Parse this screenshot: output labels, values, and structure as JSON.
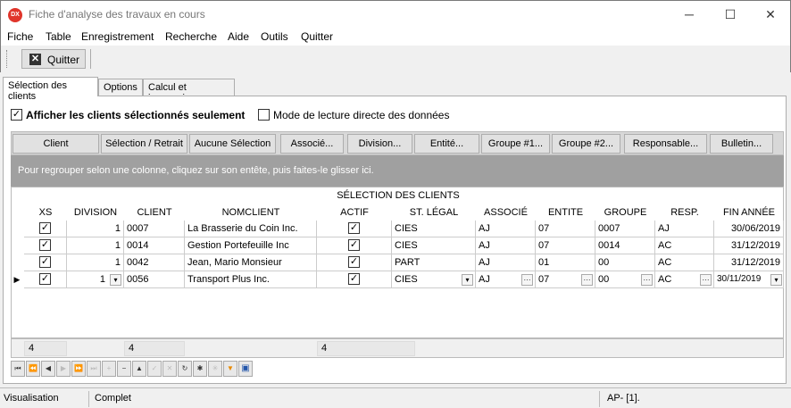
{
  "window": {
    "title": "Fiche d'analyse des travaux en cours",
    "icon_text": "DX",
    "minimize": "─",
    "maximize": "☐",
    "close": "✕"
  },
  "menu": [
    "Fiche",
    "Table",
    "Enregistrement",
    "Recherche",
    "Aide",
    "Outils",
    "Quitter"
  ],
  "toolbar": {
    "quit_label": "Quitter"
  },
  "tabs": [
    "Sélection des clients",
    "Options",
    "Calcul et impression"
  ],
  "options": {
    "show_selected_label": "Afficher les clients sélectionnés seulement",
    "show_selected_checked": true,
    "direct_read_label": "Mode de lecture directe des données",
    "direct_read_checked": false
  },
  "buttons": [
    "Client",
    "Sélection / Retrait",
    "Aucune Sélection",
    "Associé...",
    "Division...",
    "Entité...",
    "Groupe #1...",
    "Groupe #2...",
    "Responsable...",
    "Bulletin..."
  ],
  "group_hint": "Pour regrouper selon une colonne, cliquez sur son entête, puis faites-le glisser ici.",
  "grid": {
    "title": "SÉLECTION DES CLIENTS",
    "columns": [
      "XS",
      "DIVISION",
      "CLIENT",
      "NOMCLIENT",
      "ACTIF",
      "ST. LÉGAL",
      "ASSOCIÉ",
      "ENTITE",
      "GROUPE",
      "RESP.",
      "FIN ANNÉE"
    ],
    "rows": [
      {
        "xs": true,
        "division": "1",
        "client": "0007",
        "nom": "La Brasserie du Coin Inc.",
        "actif": true,
        "legal": "CIES",
        "associe": "AJ",
        "entite": "07",
        "groupe": "0007",
        "resp": "AJ",
        "fin": "30/06/2019"
      },
      {
        "xs": true,
        "division": "1",
        "client": "0014",
        "nom": "Gestion Portefeuille Inc",
        "actif": true,
        "legal": "CIES",
        "associe": "AJ",
        "entite": "07",
        "groupe": "0014",
        "resp": "AC",
        "fin": "31/12/2019"
      },
      {
        "xs": true,
        "division": "1",
        "client": "0042",
        "nom": "Jean, Mario Monsieur",
        "actif": true,
        "legal": "PART",
        "associe": "AJ",
        "entite": "01",
        "groupe": "00",
        "resp": "AC",
        "fin": "31/12/2019"
      },
      {
        "xs": true,
        "division": "1",
        "client": "0056",
        "nom": "Transport Plus Inc.",
        "actif": true,
        "legal": "CIES",
        "associe": "AJ",
        "entite": "07",
        "groupe": "00",
        "resp": "AC",
        "fin": "30/11/2019"
      }
    ],
    "footer": [
      "4",
      "4",
      "4"
    ]
  },
  "status": [
    "Visualisation",
    "Complet",
    "AP- [1]."
  ]
}
